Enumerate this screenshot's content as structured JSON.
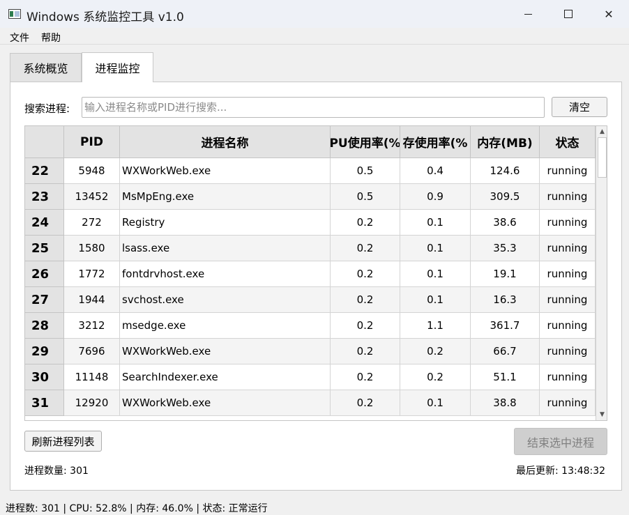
{
  "window": {
    "title": "Windows 系统监控工具 v1.0",
    "controls": {
      "minimize": "minimize-icon",
      "maximize": "maximize-icon",
      "close": "✕"
    }
  },
  "menu": [
    "文件",
    "帮助"
  ],
  "tabs": [
    {
      "label": "系统概览",
      "active": false
    },
    {
      "label": "进程监控",
      "active": true
    }
  ],
  "search": {
    "label": "搜索进程:",
    "placeholder": "输入进程名称或PID进行搜索...",
    "value": "",
    "clear_label": "清空"
  },
  "table": {
    "columns": [
      "PID",
      "进程名称",
      "PU使用率(%",
      "存使用率(%",
      "内存(MB)",
      "状态"
    ],
    "rows": [
      {
        "index": "22",
        "pid": "5948",
        "name": "WXWorkWeb.exe",
        "cpu": "0.5",
        "mem_pct": "0.4",
        "mem_mb": "124.6",
        "status": "running"
      },
      {
        "index": "23",
        "pid": "13452",
        "name": "MsMpEng.exe",
        "cpu": "0.5",
        "mem_pct": "0.9",
        "mem_mb": "309.5",
        "status": "running"
      },
      {
        "index": "24",
        "pid": "272",
        "name": "Registry",
        "cpu": "0.2",
        "mem_pct": "0.1",
        "mem_mb": "38.6",
        "status": "running"
      },
      {
        "index": "25",
        "pid": "1580",
        "name": "lsass.exe",
        "cpu": "0.2",
        "mem_pct": "0.1",
        "mem_mb": "35.3",
        "status": "running"
      },
      {
        "index": "26",
        "pid": "1772",
        "name": "fontdrvhost.exe",
        "cpu": "0.2",
        "mem_pct": "0.1",
        "mem_mb": "19.1",
        "status": "running"
      },
      {
        "index": "27",
        "pid": "1944",
        "name": "svchost.exe",
        "cpu": "0.2",
        "mem_pct": "0.1",
        "mem_mb": "16.3",
        "status": "running"
      },
      {
        "index": "28",
        "pid": "3212",
        "name": "msedge.exe",
        "cpu": "0.2",
        "mem_pct": "1.1",
        "mem_mb": "361.7",
        "status": "running"
      },
      {
        "index": "29",
        "pid": "7696",
        "name": "WXWorkWeb.exe",
        "cpu": "0.2",
        "mem_pct": "0.2",
        "mem_mb": "66.7",
        "status": "running"
      },
      {
        "index": "30",
        "pid": "11148",
        "name": "SearchIndexer.exe",
        "cpu": "0.2",
        "mem_pct": "0.2",
        "mem_mb": "51.1",
        "status": "running"
      },
      {
        "index": "31",
        "pid": "12920",
        "name": "WXWorkWeb.exe",
        "cpu": "0.2",
        "mem_pct": "0.1",
        "mem_mb": "38.8",
        "status": "running"
      }
    ]
  },
  "actions": {
    "refresh_label": "刷新进程列表",
    "kill_label": "结束选中进程"
  },
  "info": {
    "process_count": "进程数量: 301",
    "last_update": "最后更新: 13:48:32"
  },
  "statusbar": "进程数: 301 | CPU: 52.8% | 内存: 46.0% | 状态: 正常运行"
}
